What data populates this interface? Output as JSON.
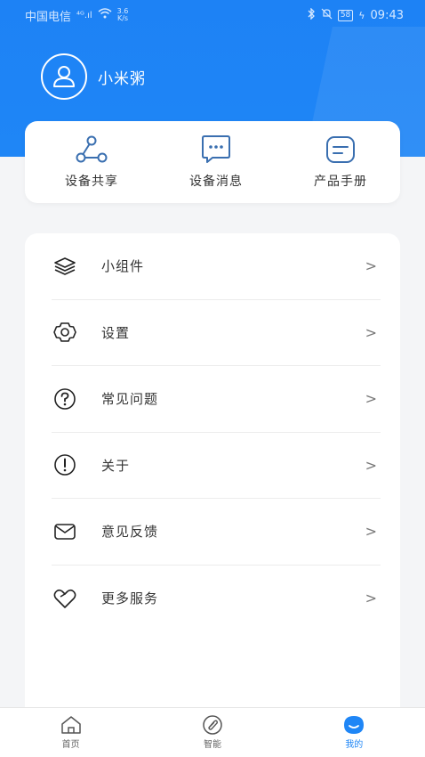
{
  "status_bar": {
    "carrier": "中国电信",
    "signal": "⁴ᴳ.ıl",
    "speed_value": "3.6",
    "speed_unit": "K/s",
    "battery": "58",
    "time": "09:43"
  },
  "profile": {
    "name": "小米粥"
  },
  "quick_actions": [
    {
      "label": "设备共享",
      "icon": "share-nodes-icon"
    },
    {
      "label": "设备消息",
      "icon": "message-bubble-icon"
    },
    {
      "label": "产品手册",
      "icon": "manual-icon"
    }
  ],
  "menu": [
    {
      "label": "小组件",
      "icon": "layers-icon"
    },
    {
      "label": "设置",
      "icon": "gear-icon"
    },
    {
      "label": "常见问题",
      "icon": "question-circle-icon"
    },
    {
      "label": "关于",
      "icon": "info-exclamation-icon"
    },
    {
      "label": "意见反馈",
      "icon": "envelope-icon"
    },
    {
      "label": "更多服务",
      "icon": "heart-hand-icon"
    }
  ],
  "tabs": [
    {
      "label": "首页",
      "icon": "home-icon"
    },
    {
      "label": "智能",
      "icon": "smart-link-icon"
    },
    {
      "label": "我的",
      "icon": "mine-face-icon"
    }
  ],
  "colors": {
    "primary": "#1f86f6",
    "background": "#f4f5f7",
    "icon_blue": "#3a6fb0"
  }
}
